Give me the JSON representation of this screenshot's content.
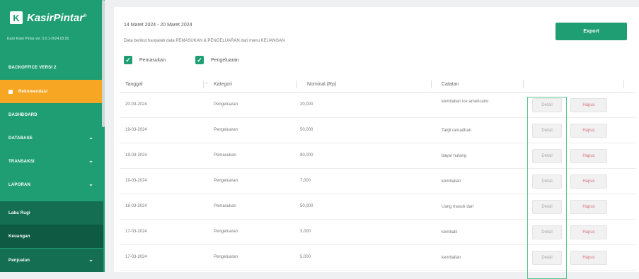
{
  "sidebar": {
    "brand": "KasirPintar",
    "brand_mark": "K",
    "brand_tm": "®",
    "version": "Kasir Kasir Pintar ver. 0.0.1-2024.03.05",
    "items": [
      {
        "label": "BACKOFFICE VERSI 2",
        "type": "section"
      },
      {
        "label": "Rekomendasi",
        "type": "active"
      },
      {
        "label": "DASHBOARD",
        "type": "plain"
      },
      {
        "label": "DATABASE",
        "type": "expand"
      },
      {
        "label": "TRANSAKSI",
        "type": "expand"
      },
      {
        "label": "LAPORAN",
        "type": "expand"
      },
      {
        "label": "Laba Rugi",
        "type": "sub"
      },
      {
        "label": "Keuangan",
        "type": "sub"
      },
      {
        "label": "Penjualan",
        "type": "sub-expand"
      }
    ]
  },
  "header": {
    "date_range": "14 Maret 2024 - 20 Maret 2024",
    "description": "Data berikut hanyalah data PEMASUKAN & PENGELUARAN dari menu KEUANGAN",
    "export_label": "Export"
  },
  "filters": [
    {
      "label": "Pemasukan",
      "checked": true
    },
    {
      "label": "Pengeluaran",
      "checked": true
    }
  ],
  "table": {
    "columns": [
      "Tanggal",
      "Kategori",
      "Nominal (Rp)",
      "Catatan"
    ],
    "detail_label": "Detail",
    "delete_label": "Hapus",
    "rows": [
      {
        "date": "20-03-2024",
        "category": "Pengeluaran",
        "amount": "20,000",
        "note": "kembalian ice americano"
      },
      {
        "date": "19-03-2024",
        "category": "Pengeluaran",
        "amount": "50,000",
        "note": "Takjil ramadhan"
      },
      {
        "date": "19-03-2024",
        "category": "Pemasukan",
        "amount": "80,000",
        "note": "bayar hutang"
      },
      {
        "date": "19-03-2024",
        "category": "Pengeluaran",
        "amount": "7,000",
        "note": "kembalian"
      },
      {
        "date": "18-03-2024",
        "category": "Pemasukan",
        "amount": "50,000",
        "note": "Uang masuk dari"
      },
      {
        "date": "17-03-2024",
        "category": "Pengeluaran",
        "amount": "3,000",
        "note": "kembalii"
      },
      {
        "date": "17-03-2024",
        "category": "Pengeluaran",
        "amount": "5,000",
        "note": "kembalian"
      }
    ]
  },
  "colors": {
    "brand": "#1f9e73",
    "active": "#f6a623",
    "danger": "#d9727c"
  }
}
